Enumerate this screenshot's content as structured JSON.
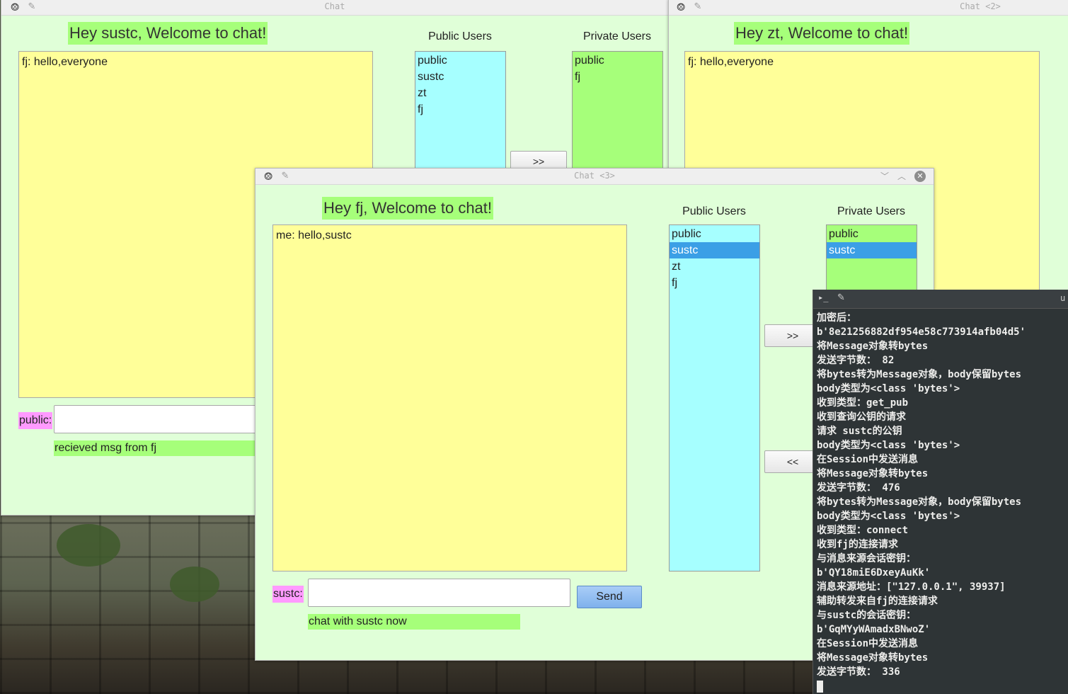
{
  "desktop": {
    "background": "stone ruins wallpaper"
  },
  "windows": {
    "w1": {
      "title": "Chat",
      "welcome": "Hey sustc, Welcome to  chat!",
      "messages": [
        "fj: hello,everyone"
      ],
      "public_users_label": "Public Users",
      "private_users_label": "Private Users",
      "public_users": [
        "public",
        "sustc",
        "zt",
        "fj"
      ],
      "private_users": [
        "public",
        "fj"
      ],
      "add_button": ">>",
      "input_label": "public:",
      "input_value": "",
      "status": "recieved msg from fj"
    },
    "w2": {
      "title": "Chat <2>",
      "welcome": "Hey zt, Welcome to  chat!",
      "messages": [
        "fj: hello,everyone"
      ]
    },
    "w3": {
      "title": "Chat <3>",
      "welcome": "Hey fj, Welcome to  chat!",
      "messages": [
        "me: hello,sustc"
      ],
      "public_users_label": "Public Users",
      "private_users_label": "Private Users",
      "public_users": [
        "public",
        "sustc",
        "zt",
        "fj"
      ],
      "public_selected": "sustc",
      "private_users": [
        "public",
        "sustc"
      ],
      "private_selected": "sustc",
      "add_button": ">>",
      "remove_button": "<<",
      "input_label": "sustc:",
      "input_value": "",
      "send_button": "Send",
      "status": "chat with sustc now"
    }
  },
  "terminal": {
    "title_fragment": "u",
    "lines": [
      "加密后：",
      "b'8e21256882df954e58c773914afb04d5'",
      "将Message对象转bytes",
      "发送字节数： 82",
      "将bytes转为Message对象，body保留bytes",
      "body类型为<class 'bytes'>",
      "收到类型：get_pub",
      "收到查询公钥的请求",
      "请求 sustc的公钥",
      "body类型为<class 'bytes'>",
      "在Session中发送消息",
      "将Message对象转bytes",
      "发送字节数： 476",
      "将bytes转为Message对象，body保留bytes",
      "body类型为<class 'bytes'>",
      "收到类型：connect",
      "收到fj的连接请求",
      "与消息来源会话密钥：",
      "b'QY18miE6DxeyAuKk'",
      "消息来源地址：[\"127.0.0.1\", 39937]",
      "辅助转发来自fj的连接请求",
      "与sustc的会话密钥：",
      "b'GqMYyWAmadxBNwoZ'",
      "在Session中发送消息",
      "将Message对象转bytes",
      "发送字节数： 336"
    ]
  },
  "colors": {
    "window_bg": "#e0ffd8",
    "welcome_bg": "#a6ff7a",
    "chat_bg": "#ffff99",
    "public_list_bg": "#a6ffff",
    "private_list_bg": "#a6ff7a",
    "label_bg": "#ff9aff",
    "selection": "#3b9fe6",
    "send_button": "#8fbdf0",
    "terminal_bg": "#2e3436"
  }
}
